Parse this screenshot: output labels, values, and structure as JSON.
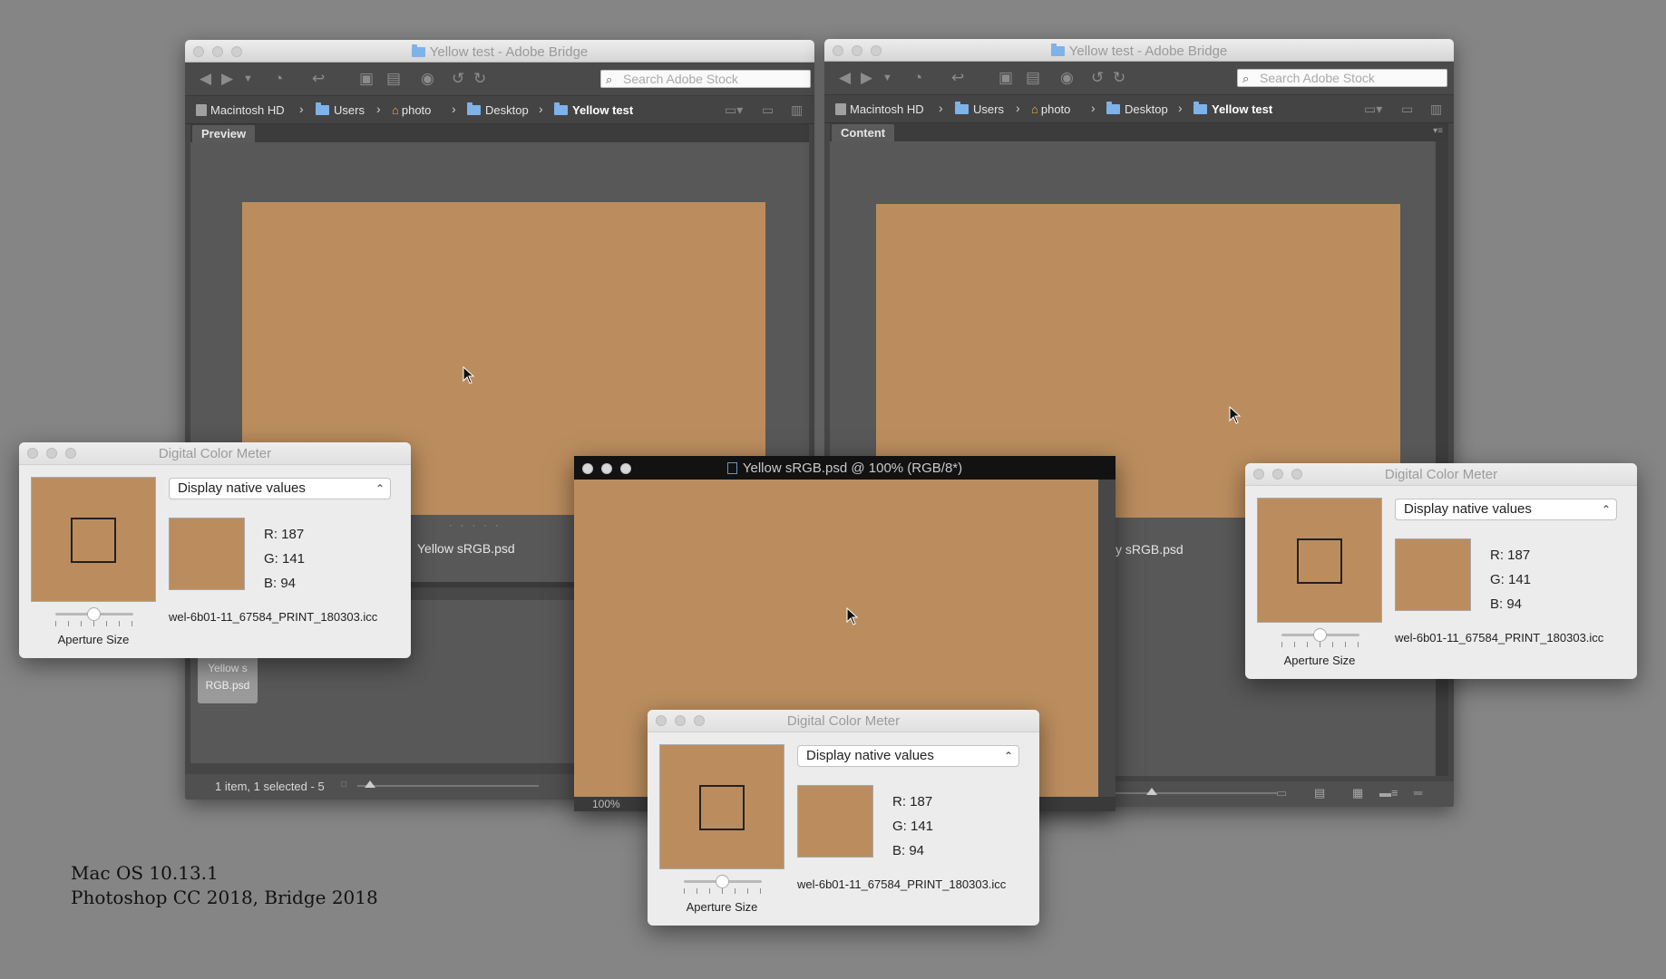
{
  "colors": {
    "sample": "#bb8d5e",
    "desktop": "#858585"
  },
  "bridge_left": {
    "title": "Yellow test - Adobe Bridge",
    "search_placeholder": "Search Adobe Stock",
    "breadcrumbs": [
      "Macintosh HD",
      "Users",
      "photo",
      "Desktop",
      "Yellow test"
    ],
    "panel_tab": "Preview",
    "preview_filename": "Yellow sRGB.psd",
    "thumb_label_1": "Yellow s",
    "thumb_label_2": "RGB.psd",
    "status": "1 item, 1 selected - 5"
  },
  "bridge_right": {
    "title": "Yellow test - Adobe Bridge",
    "search_placeholder": "Search Adobe Stock",
    "breadcrumbs": [
      "Macintosh HD",
      "Users",
      "photo",
      "Desktop",
      "Yellow test"
    ],
    "panel_tab": "Content",
    "file_label_partial": "y sRGB.psd"
  },
  "photoshop": {
    "title": "Yellow sRGB.psd @ 100% (RGB/8*)",
    "zoom": "100%"
  },
  "color_meters": [
    {
      "title": "Digital Color Meter",
      "mode": "Display native values",
      "r": "R: 187",
      "g": "G: 141",
      "b": "B: 94",
      "profile": "wel-6b01-11_67584_PRINT_180303.icc",
      "aperture_label": "Aperture Size"
    },
    {
      "title": "Digital Color Meter",
      "mode": "Display native values",
      "r": "R: 187",
      "g": "G: 141",
      "b": "B: 94",
      "profile": "wel-6b01-11_67584_PRINT_180303.icc",
      "aperture_label": "Aperture Size"
    },
    {
      "title": "Digital Color Meter",
      "mode": "Display native values",
      "r": "R: 187",
      "g": "G: 141",
      "b": "B: 94",
      "profile": "wel-6b01-11_67584_PRINT_180303.icc",
      "aperture_label": "Aperture Size"
    }
  ],
  "caption": {
    "line1": "Mac OS 10.13.1",
    "line2": "Photoshop CC 2018, Bridge 2018"
  }
}
